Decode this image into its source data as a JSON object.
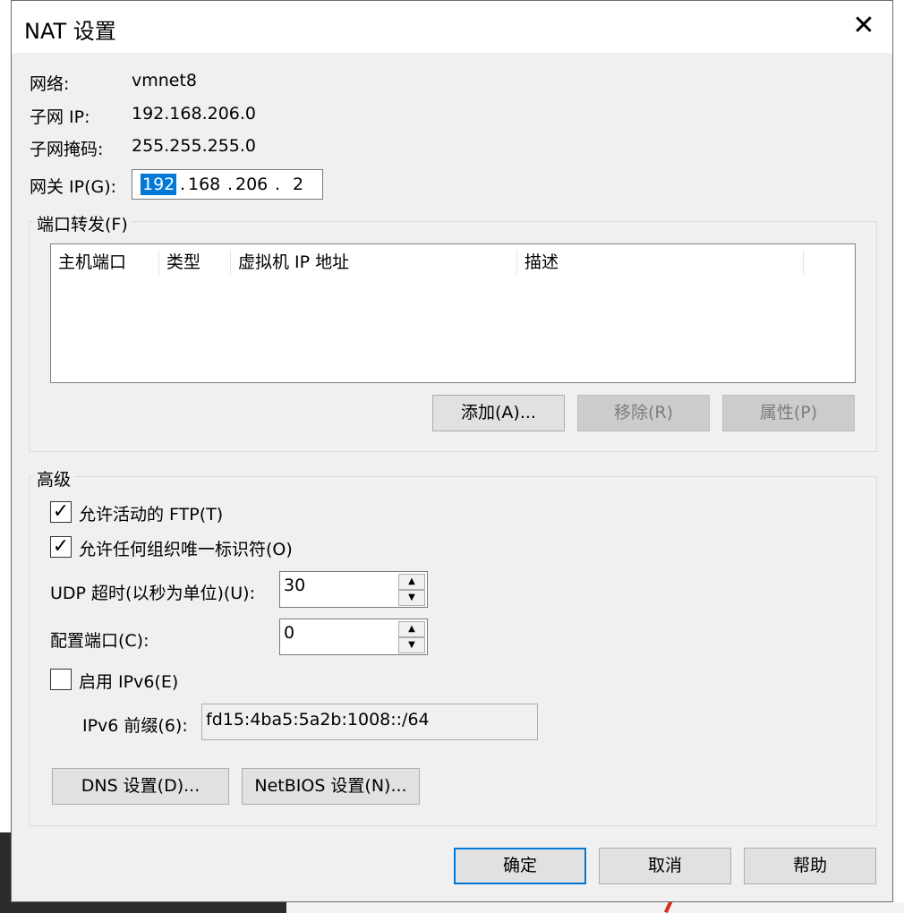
{
  "window": {
    "title": "NAT 设置",
    "close_glyph": "✕"
  },
  "info": {
    "network_label": "网络:",
    "network_value": "vmnet8",
    "subnet_ip_label": "子网 IP:",
    "subnet_ip_value": "192.168.206.0",
    "subnet_mask_label": "子网掩码:",
    "subnet_mask_value": "255.255.255.0",
    "gateway_label": "网关 IP(G):",
    "gateway": [
      "192",
      "168",
      "206",
      "2"
    ]
  },
  "port_forwarding": {
    "group_title": "端口转发(F)",
    "columns": [
      "主机端口",
      "类型",
      "虚拟机 IP 地址",
      "描述"
    ],
    "rows": [],
    "add_label": "添加(A)...",
    "remove_label": "移除(R)",
    "properties_label": "属性(P)"
  },
  "advanced": {
    "group_title": "高级",
    "allow_ftp_label": "允许活动的 FTP(T)",
    "allow_ftp_checked": true,
    "allow_oui_label": "允许任何组织唯一标识符(O)",
    "allow_oui_checked": true,
    "udp_timeout_label": "UDP 超时(以秒为单位)(U):",
    "udp_timeout_value": "30",
    "config_port_label": "配置端口(C):",
    "config_port_value": "0",
    "enable_ipv6_label": "启用 IPv6(E)",
    "enable_ipv6_checked": false,
    "ipv6_prefix_label": "IPv6 前缀(6):",
    "ipv6_prefix_value": "fd15:4ba5:5a2b:1008::/64",
    "dns_label": "DNS 设置(D)...",
    "netbios_label": "NetBIOS 设置(N)..."
  },
  "footer": {
    "ok_label": "确定",
    "cancel_label": "取消",
    "help_label": "帮助"
  },
  "colors": {
    "accent": "#0078d7",
    "dialog_bg": "#f0f0f0"
  }
}
